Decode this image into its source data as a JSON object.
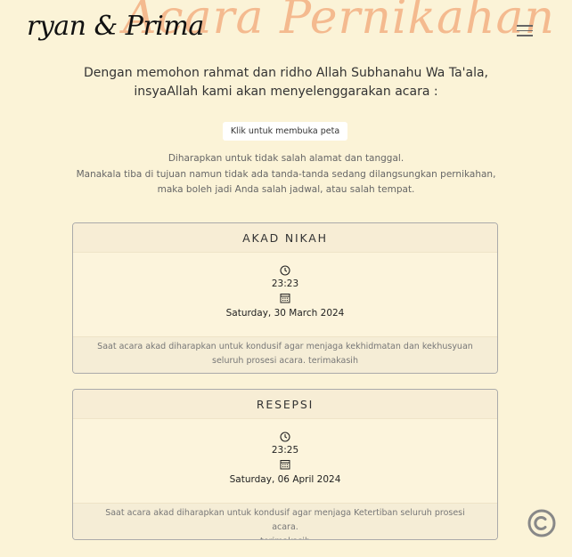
{
  "header": {
    "background_title": "Acara Pernikahan",
    "brand": "ryan & Prima"
  },
  "intro": {
    "line1": "Dengan memohon rahmat dan ridho Allah Subhanahu Wa Ta'ala,",
    "line2": "insyaAllah kami akan menyelenggarakan acara :"
  },
  "map_button_label": "Klik untuk membuka peta",
  "notice": {
    "line1": "Diharapkan untuk tidak salah alamat dan tanggal.",
    "line2": "Manakala tiba di tujuan namun tidak ada tanda-tanda sedang dilangsungkan pernikahan,",
    "line3": "maka boleh jadi Anda salah jadwal, atau salah tempat."
  },
  "events": [
    {
      "title": "AKAD NIKAH",
      "time": "23:23",
      "date": "Saturday, 30 March 2024",
      "note_line1": "Saat acara akad diharapkan untuk kondusif agar menjaga kekhidmatan dan kekhusyuan",
      "note_line2": "seluruh prosesi acara. terimakasih"
    },
    {
      "title": "RESEPSI",
      "time": "23:25",
      "date": "Saturday, 06 April 2024",
      "note_line1": "Saat acara akad diharapkan untuk kondusif agar menjaga Ketertiban seluruh prosesi acara.",
      "note_line2": "terimakasih"
    }
  ],
  "icons": {
    "menu": "hamburger-menu-icon",
    "time": "clock-icon",
    "date": "calendar-icon",
    "floating": "music-disc-icon"
  },
  "colors": {
    "background": "#fbf3d7",
    "accent_title": "#f4b488"
  }
}
